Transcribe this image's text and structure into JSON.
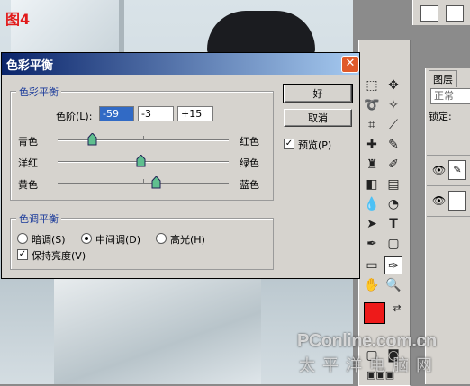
{
  "figure_label": "图4",
  "dialog": {
    "title": "色彩平衡",
    "close_glyph": "✕",
    "color_balance_group": "色彩平衡",
    "levels_label": "色阶(L):",
    "levels_values": [
      "-59",
      "-3",
      "+15"
    ],
    "sliders": [
      {
        "left": "青色",
        "right": "红色",
        "value": -59
      },
      {
        "left": "洋红",
        "right": "绿色",
        "value": -3
      },
      {
        "left": "黄色",
        "right": "蓝色",
        "value": 15
      }
    ],
    "tone_group": "色调平衡",
    "tones": [
      {
        "label": "暗调(S)",
        "selected": false
      },
      {
        "label": "中间调(D)",
        "selected": true
      },
      {
        "label": "高光(H)",
        "selected": false
      }
    ],
    "preserve_luminosity": {
      "label": "保持亮度(V)",
      "checked": true
    },
    "ok_label": "好",
    "cancel_label": "取消",
    "preview": {
      "label": "预览(P)",
      "checked": true
    }
  },
  "layers_panel": {
    "tab": "图层",
    "blend_mode": "正常",
    "lock_label": "锁定:"
  },
  "foreground_color": "#ee1a1a",
  "watermark": {
    "main": "PConline.com.cn",
    "sub": "太平洋电脑网"
  }
}
